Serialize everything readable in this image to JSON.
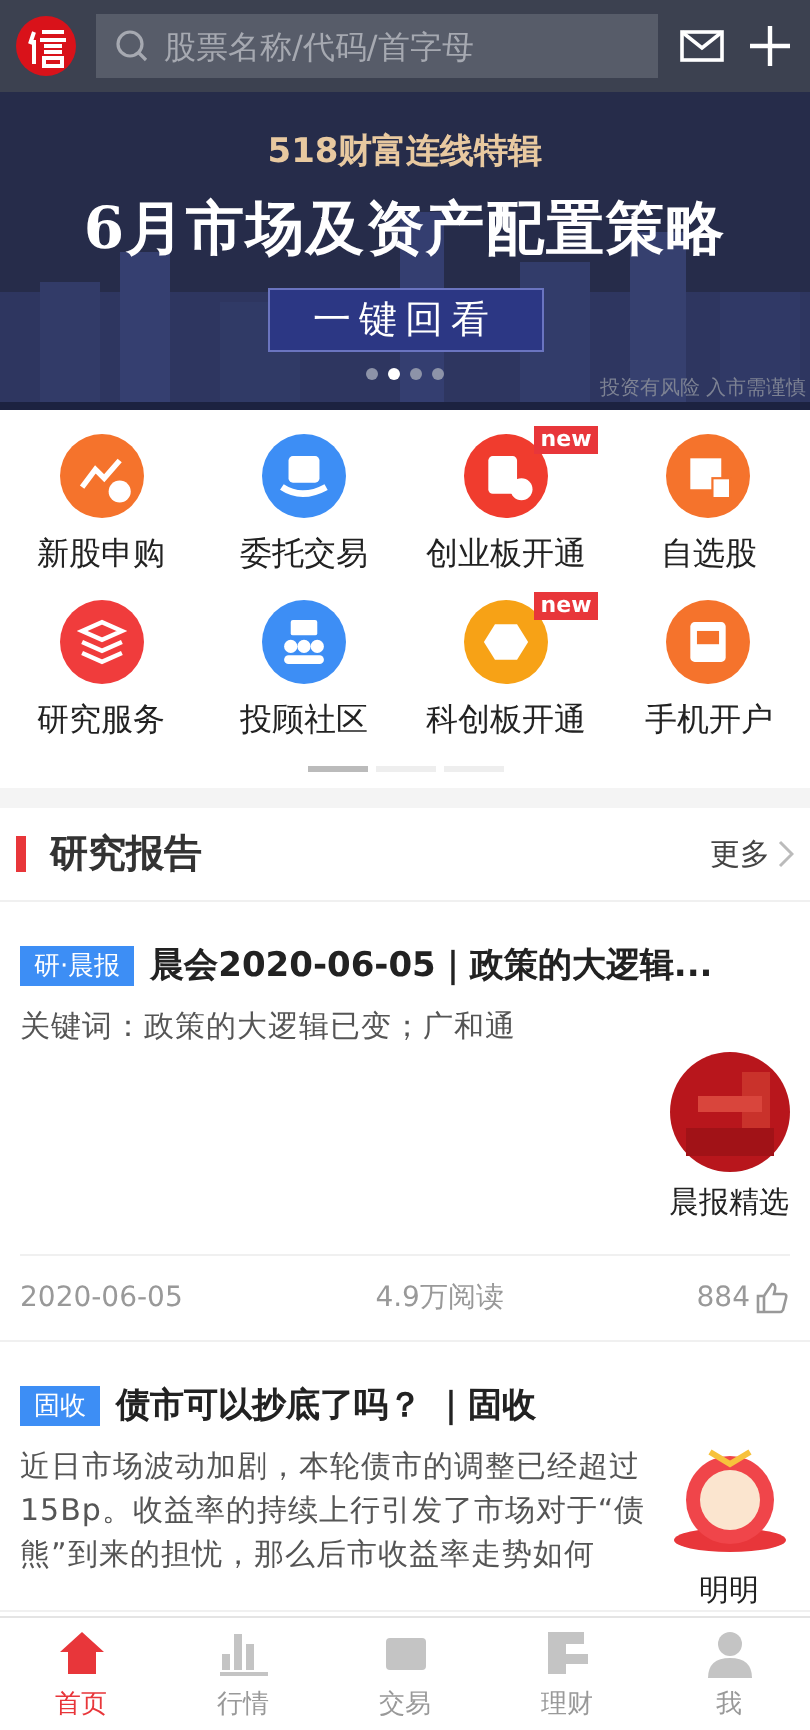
{
  "header": {
    "search": {
      "placeholder": "股票名称/代码/首字母"
    }
  },
  "banner": {
    "kind": "picture",
    "subtitle": "518财富连线特辑",
    "title": "6月市场及资产配置策略",
    "button": "一键回看",
    "disclaimer": "投资有风险 入市需谨慎",
    "dots": [
      {
        "selected": false
      },
      {
        "selected": true
      },
      {
        "selected": false
      },
      {
        "selected": false
      }
    ]
  },
  "shortcuts": [
    {
      "label": "新股申购",
      "color": "#f5732c"
    },
    {
      "label": "委托交易",
      "color": "#3d8ef5"
    },
    {
      "label": "创业板开通",
      "color": "#f03c2e",
      "badge": "new"
    },
    {
      "label": "自选股",
      "color": "#f5732c"
    },
    {
      "label": "研究服务",
      "color": "#f03c3c"
    },
    {
      "label": "投顾社区",
      "color": "#3d8ef5"
    },
    {
      "label": "科创板开通",
      "color": "#f7a216",
      "badge": "new"
    },
    {
      "label": "手机开户",
      "color": "#f5732c"
    }
  ],
  "shortcut_pages": [
    {
      "selected": true
    },
    {
      "selected": false
    },
    {
      "selected": false
    }
  ],
  "section": {
    "title": "研究报告",
    "more": "更多"
  },
  "articles": [
    {
      "tag": "研·晨报",
      "title": "晨会2020-06-05｜政策的大逻辑...",
      "body": "关键词：政策的大逻辑已变；广和通",
      "thumb_label": "晨报精选",
      "date": "2020-06-05",
      "reads": "4.9万阅读",
      "likes": "884"
    },
    {
      "tag": "固收",
      "title": "债市可以抄底了吗？ ｜固收",
      "body": "近日市场波动加剧，本轮债市的调整已经超过15Bp。收益率的持续上行引发了市场对于“债熊”到来的担忧，那么后市收益率走势如何",
      "thumb_label": "明明"
    }
  ],
  "tab_bar": [
    {
      "label": "首页",
      "selected": true
    },
    {
      "label": "行情",
      "selected": false
    },
    {
      "label": "交易",
      "selected": false
    },
    {
      "label": "理财",
      "selected": false
    },
    {
      "label": "我",
      "selected": false
    }
  ]
}
